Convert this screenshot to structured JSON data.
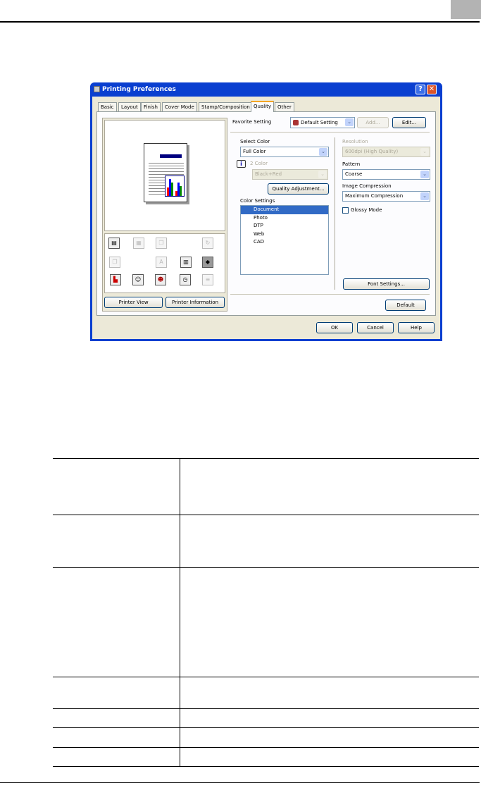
{
  "dialog": {
    "title": "Printing Preferences",
    "help_btn": "?",
    "close_btn": "✕",
    "tabs": [
      "Basic",
      "Layout",
      "Finish",
      "Cover Mode",
      "Stamp/Composition",
      "Quality",
      "Other"
    ],
    "favorite_label": "Favorite Setting",
    "favorite_value": "Default Setting",
    "add_label": "Add...",
    "edit_label": "Edit...",
    "select_color_label": "Select Color",
    "select_color_value": "Full Color",
    "two_color_label": "2 Color",
    "two_color_value": "Black+Red",
    "quality_adjust_label": "Quality Adjustment...",
    "color_settings_label": "Color Settings",
    "color_settings_items": [
      "Document",
      "Photo",
      "DTP",
      "Web",
      "CAD"
    ],
    "resolution_label": "Resolution",
    "resolution_value": "600dpi (High Quality)",
    "pattern_label": "Pattern",
    "pattern_value": "Coarse",
    "image_compression_label": "Image Compression",
    "image_compression_value": "Maximum Compression",
    "glossy_label": "Glossy Mode",
    "font_settings_label": "Font Settings...",
    "default_label": "Default",
    "printer_view_label": "Printer View",
    "printer_info_label": "Printer Information",
    "ok_label": "OK",
    "cancel_label": "Cancel",
    "help_label": "Help"
  }
}
